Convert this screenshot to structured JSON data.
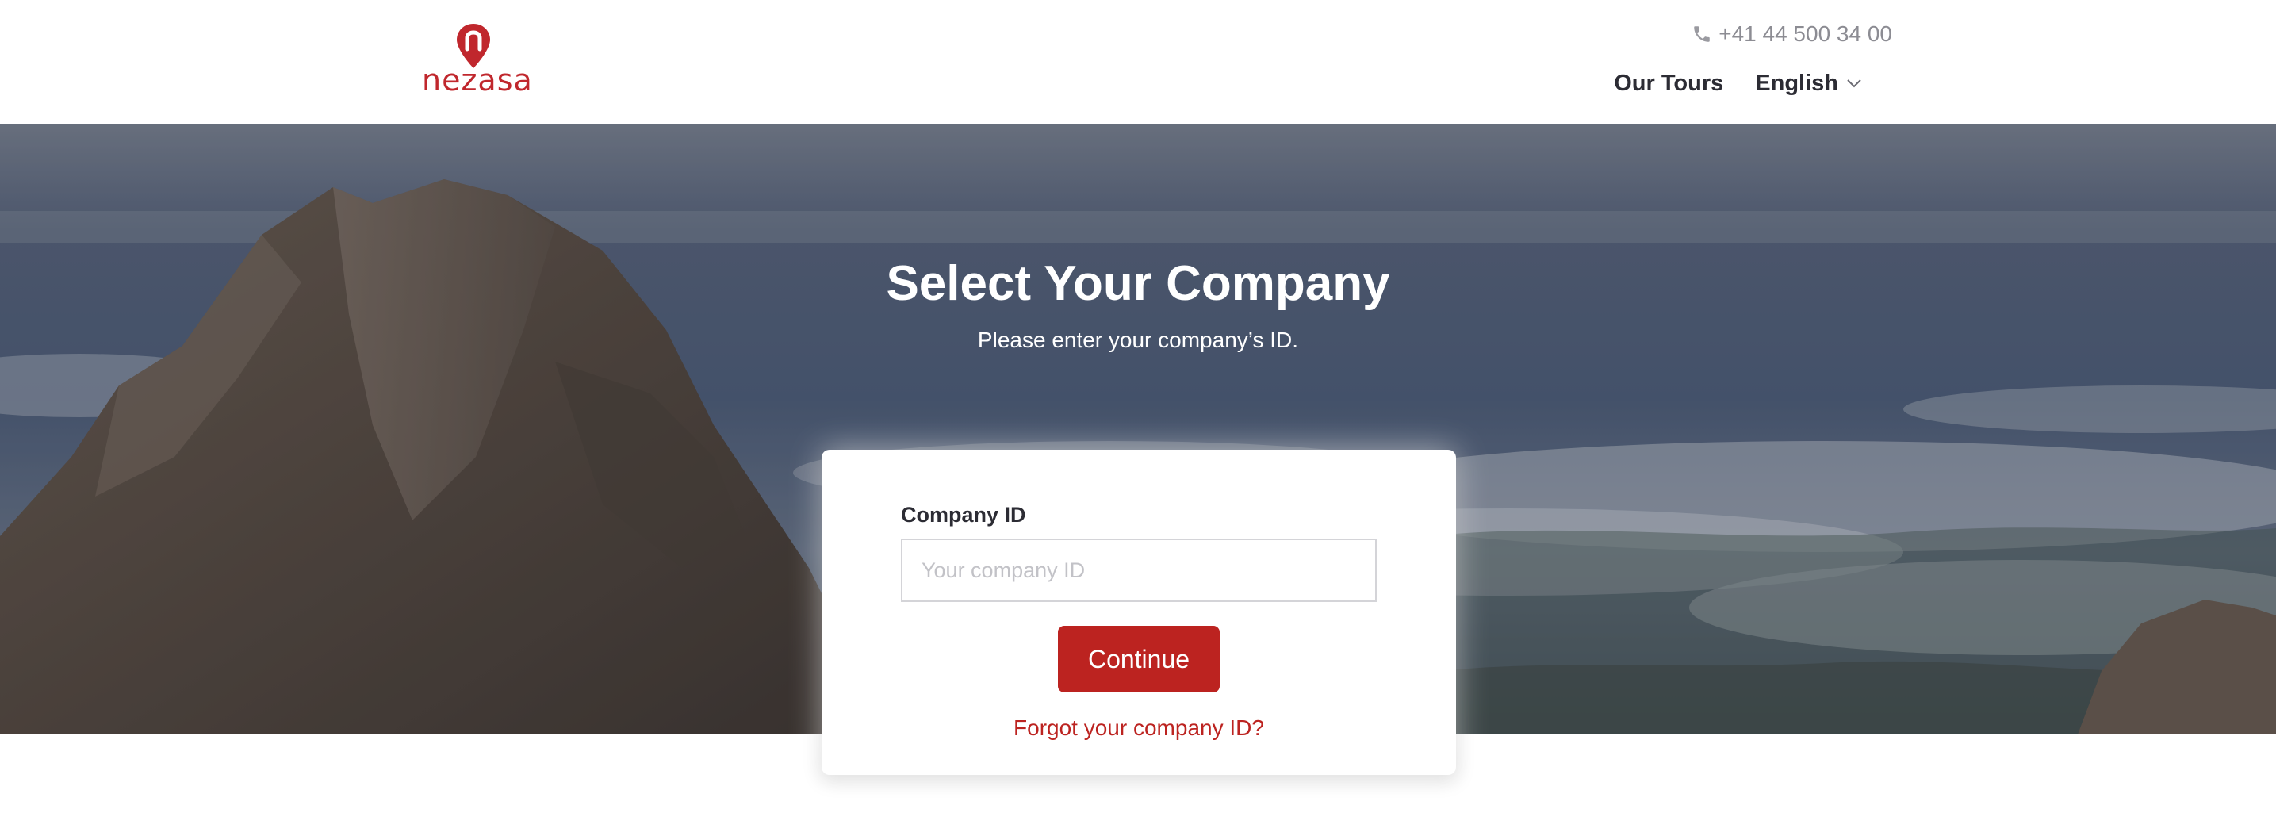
{
  "header": {
    "logo_text": "nezasa",
    "phone": "+41 44 500 34 00",
    "nav": {
      "tours_label": "Our Tours",
      "language_label": "English"
    }
  },
  "hero": {
    "title": "Select Your Company",
    "subtitle": "Please enter your company’s ID."
  },
  "form": {
    "company_id_label": "Company ID",
    "company_id_placeholder": "Your company ID",
    "company_id_value": "",
    "continue_label": "Continue",
    "forgot_label": "Forgot your company ID?"
  },
  "icons": {
    "phone": "phone-icon",
    "language_dropdown": "chevron-down-icon",
    "logo": "location-pin-icon"
  },
  "colors": {
    "brand_red": "#bc2320",
    "logo_red": "#c0272d",
    "text_dark": "#2c2c34",
    "text_muted": "#8c8c93"
  }
}
